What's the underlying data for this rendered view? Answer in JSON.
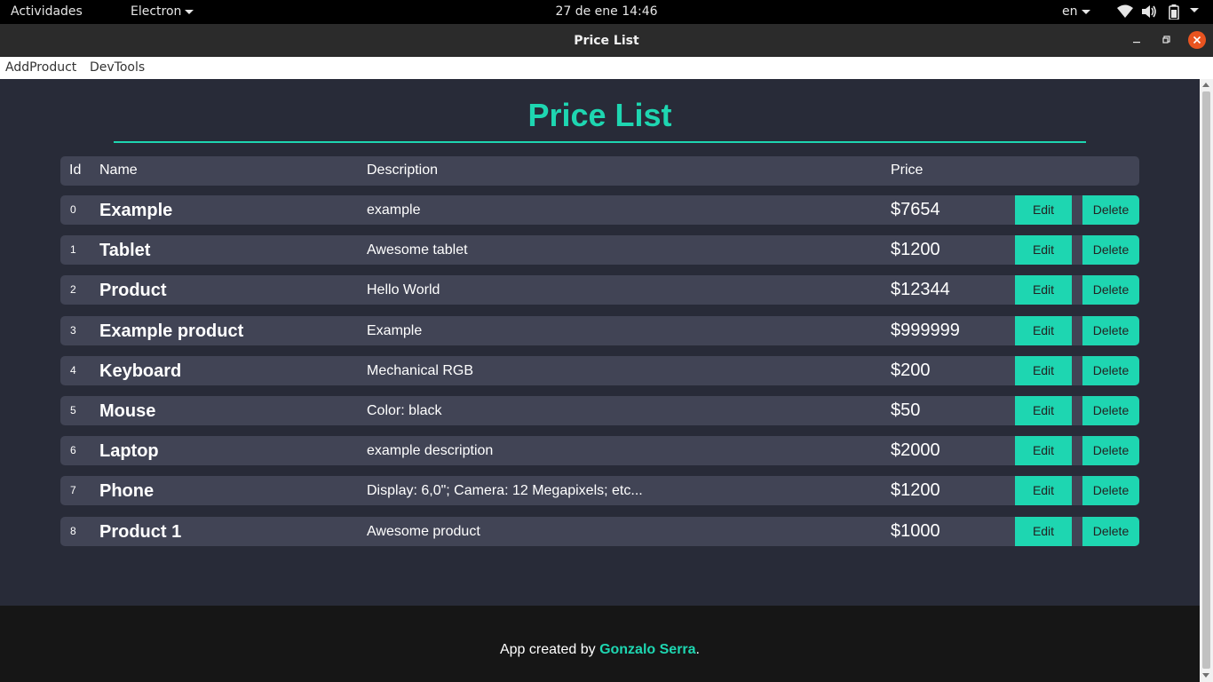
{
  "system_bar": {
    "activities": "Actividades",
    "app_menu": "Electron",
    "clock": "27 de ene  14:46",
    "language": "en"
  },
  "window": {
    "title": "Price List"
  },
  "menu": {
    "items": [
      "AddProduct",
      "DevTools"
    ]
  },
  "page": {
    "heading": "Price List",
    "accent_color": "#1ed6b1",
    "table": {
      "headers": {
        "id": "Id",
        "name": "Name",
        "description": "Description",
        "price": "Price"
      },
      "edit_label": "Edit",
      "delete_label": "Delete",
      "rows": [
        {
          "id": "0",
          "name": "Example",
          "description": "example",
          "price": "$7654"
        },
        {
          "id": "1",
          "name": "Tablet",
          "description": "Awesome tablet",
          "price": "$1200"
        },
        {
          "id": "2",
          "name": "Product",
          "description": "Hello World",
          "price": "$12344"
        },
        {
          "id": "3",
          "name": "Example product",
          "description": "Example",
          "price": "$999999"
        },
        {
          "id": "4",
          "name": "Keyboard",
          "description": "Mechanical RGB",
          "price": "$200"
        },
        {
          "id": "5",
          "name": "Mouse",
          "description": "Color: black",
          "price": "$50"
        },
        {
          "id": "6",
          "name": "Laptop",
          "description": "example description",
          "price": "$2000"
        },
        {
          "id": "7",
          "name": "Phone",
          "description": "Display: 6,0\"; Camera: 12 Megapixels; etc...",
          "price": "$1200"
        },
        {
          "id": "8",
          "name": "Product 1",
          "description": "Awesome product",
          "price": "$1000"
        }
      ]
    }
  },
  "footer": {
    "prefix": "App created by ",
    "author": "Gonzalo Serra",
    "suffix": "."
  }
}
